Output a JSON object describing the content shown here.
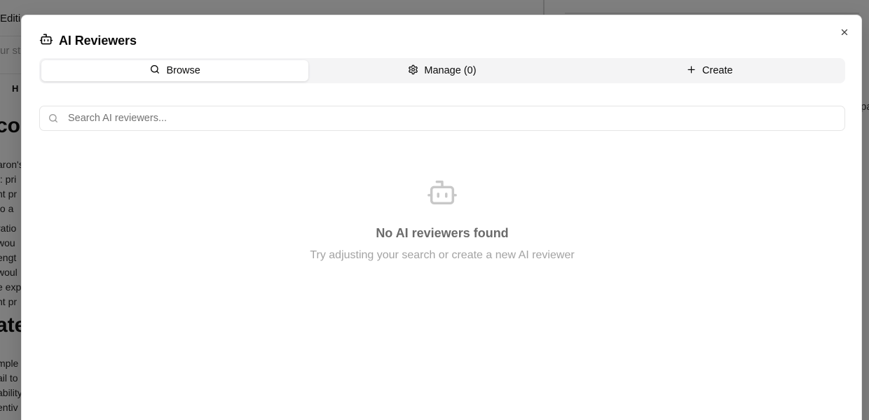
{
  "background": {
    "tab_label": "Editi",
    "input_placeholder": "ur st",
    "toolbar_label": "H",
    "heading_1": "co",
    "lines_1": [
      "aron's",
      "t: pri",
      "nt pr",
      " to a "
    ],
    "lines_2": [
      " ratio",
      " wou",
      "engt",
      "woul",
      "e exp",
      "nt pr"
    ],
    "heading_2": "ate",
    "lines_3": [
      "mple",
      "ail to",
      "ability",
      "entiv"
    ],
    "right_text": "pa"
  },
  "dialog": {
    "title": "AI Reviewers",
    "close_label": "×",
    "tabs": [
      {
        "label": "Browse",
        "icon": "search-icon"
      },
      {
        "label": "Manage (0)",
        "icon": "gear-icon"
      },
      {
        "label": "Create",
        "icon": "plus-icon"
      }
    ],
    "search": {
      "placeholder": "Search AI reviewers...",
      "value": ""
    },
    "empty_state": {
      "icon": "bot-icon",
      "title": "No AI reviewers found",
      "description": "Try adjusting your search or create a new AI reviewer"
    }
  },
  "colors": {
    "overlay": "#000000",
    "muted_text": "#a3a3a3",
    "tab_background": "#f4f4f5"
  }
}
